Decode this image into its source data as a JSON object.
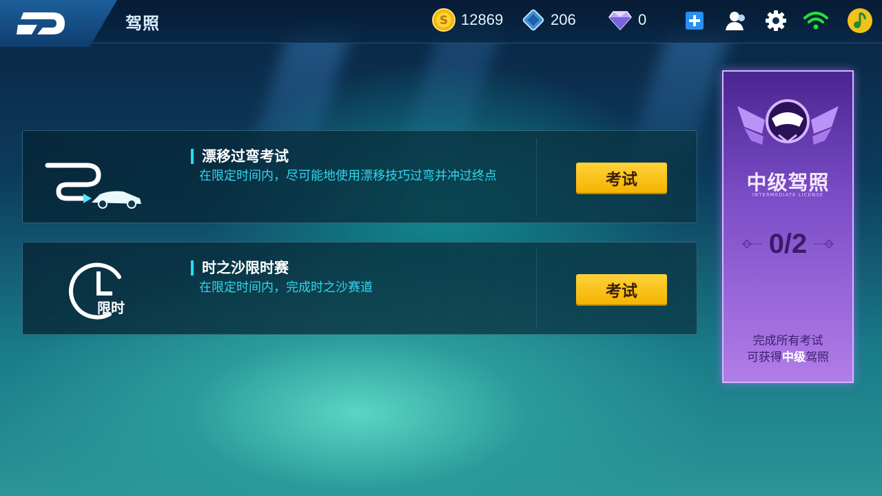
{
  "header": {
    "title": "驾照",
    "coins": "12869",
    "tickets": "206",
    "diamonds": "0"
  },
  "tests": [
    {
      "title": "漂移过弯考试",
      "description": "在限定时间内，尽可能地使用漂移技巧过弯并冲过终点",
      "button": "考试",
      "icon": "drift-car-icon"
    },
    {
      "title": "时之沙限时赛",
      "description": "在限定时间内，完成时之沙赛道",
      "button": "考试",
      "icon": "time-limit-icon",
      "icon_text": "限时"
    }
  ],
  "license": {
    "name": "中级驾照",
    "subtitle": "INTERMEDIATE LICENSE",
    "progress": "0/2",
    "line1": "完成所有考试",
    "line2_prefix": "可获得",
    "line2_highlight": "中级",
    "line2_suffix": "驾照"
  },
  "colors": {
    "accent": "#1ee0ff",
    "button": "#f4b400",
    "license": "#7b4cc6"
  }
}
